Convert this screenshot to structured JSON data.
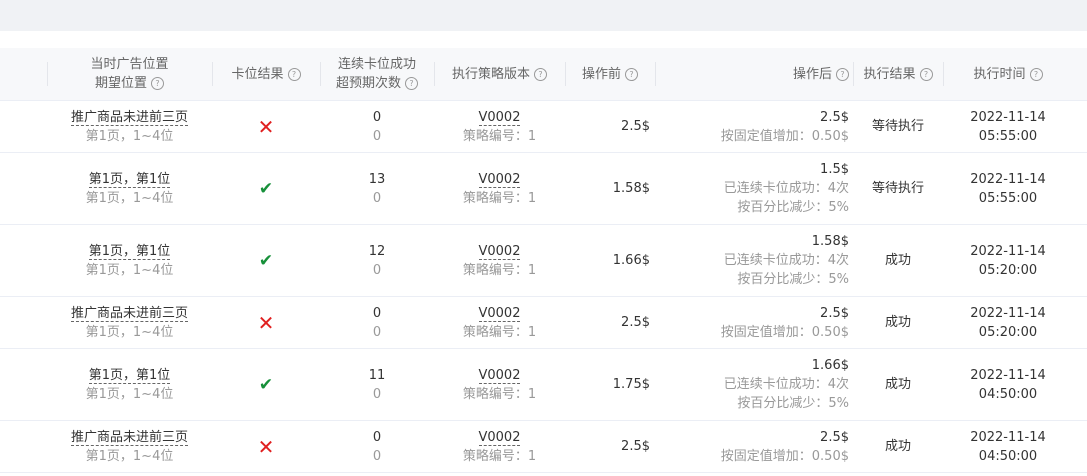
{
  "header": {
    "position_line1": "当时广告位置",
    "position_line2": "期望位置",
    "card_result": "卡位结果",
    "success_line1": "连续卡位成功",
    "success_line2": "超预期次数",
    "strategy_version": "执行策略版本",
    "before": "操作前",
    "after": "操作后",
    "exec_result": "执行结果",
    "exec_time": "执行时间",
    "help_icon": "question-circle-icon"
  },
  "rows": [
    {
      "current": "推广商品未进前三页",
      "expected": "第1页，1~4位",
      "result_icon": "cross-icon",
      "count1": "0",
      "count2": "0",
      "version": "V0002",
      "strategy_no": "策略编号：1",
      "before": "2.5$",
      "after": "2.5$",
      "after_lines": [
        "按固定值增加：0.50$"
      ],
      "status": "等待执行",
      "date": "2022-11-14",
      "time": "05:55:00"
    },
    {
      "current": "第1页，第1位",
      "expected": "第1页，1~4位",
      "result_icon": "check-icon",
      "count1": "13",
      "count2": "0",
      "version": "V0002",
      "strategy_no": "策略编号：1",
      "before": "1.58$",
      "after": "1.5$",
      "after_lines": [
        "已连续卡位成功：4次",
        "按百分比减少：5%"
      ],
      "status": "等待执行",
      "date": "2022-11-14",
      "time": "05:55:00"
    },
    {
      "current": "第1页，第1位",
      "expected": "第1页，1~4位",
      "result_icon": "check-icon",
      "count1": "12",
      "count2": "0",
      "version": "V0002",
      "strategy_no": "策略编号：1",
      "before": "1.66$",
      "after": "1.58$",
      "after_lines": [
        "已连续卡位成功：4次",
        "按百分比减少：5%"
      ],
      "status": "成功",
      "date": "2022-11-14",
      "time": "05:20:00"
    },
    {
      "current": "推广商品未进前三页",
      "expected": "第1页，1~4位",
      "result_icon": "cross-icon",
      "count1": "0",
      "count2": "0",
      "version": "V0002",
      "strategy_no": "策略编号：1",
      "before": "2.5$",
      "after": "2.5$",
      "after_lines": [
        "按固定值增加：0.50$"
      ],
      "status": "成功",
      "date": "2022-11-14",
      "time": "05:20:00"
    },
    {
      "current": "第1页，第1位",
      "expected": "第1页，1~4位",
      "result_icon": "check-icon",
      "count1": "11",
      "count2": "0",
      "version": "V0002",
      "strategy_no": "策略编号：1",
      "before": "1.75$",
      "after": "1.66$",
      "after_lines": [
        "已连续卡位成功：4次",
        "按百分比减少：5%"
      ],
      "status": "成功",
      "date": "2022-11-14",
      "time": "04:50:00"
    },
    {
      "current": "推广商品未进前三页",
      "expected": "第1页，1~4位",
      "result_icon": "cross-icon",
      "count1": "0",
      "count2": "0",
      "version": "V0002",
      "strategy_no": "策略编号：1",
      "before": "2.5$",
      "after": "2.5$",
      "after_lines": [
        "按固定值增加：0.50$"
      ],
      "status": "成功",
      "date": "2022-11-14",
      "time": "04:50:00"
    }
  ],
  "colors": {
    "success": "#17903a",
    "fail": "#e02020",
    "muted": "#999999",
    "header_bg": "#f7f8fa",
    "top_bar": "#f0f2f5"
  }
}
